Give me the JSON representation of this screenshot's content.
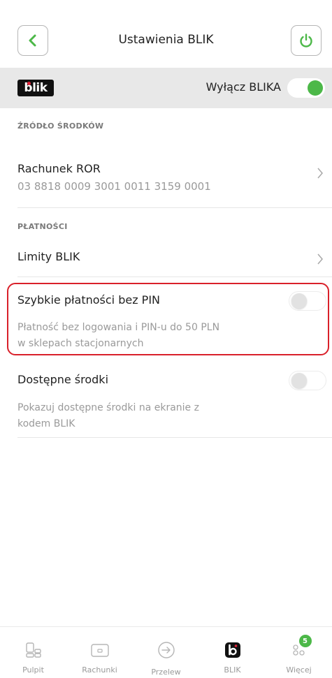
{
  "header": {
    "title": "Ustawienia BLIK",
    "back_icon": "chevron-left-icon",
    "power_icon": "power-icon"
  },
  "blik_bar": {
    "logo_text": "blik",
    "toggle_label": "Wyłącz BLIKA",
    "toggle_on": true
  },
  "source": {
    "section_label": "ŹRÓDŁO ŚRODKÓW",
    "account_name": "Rachunek ROR",
    "account_number": "03 8818 0009 3001 0011 3159 0001"
  },
  "payments": {
    "section_label": "PŁATNOŚCI",
    "limits_label": "Limity BLIK",
    "fast_payments_title": "Szybkie płatności bez PIN",
    "fast_payments_desc_line1": "Płatność bez logowania i PIN-u do 50 PLN",
    "fast_payments_desc_line2": "w sklepach stacjonarnych",
    "fast_payments_on": false,
    "available_funds_title": "Dostępne środki",
    "available_funds_desc_line1": "Pokazuj dostępne środki na ekranie z",
    "available_funds_desc_line2": "kodem BLIK",
    "available_funds_on": false
  },
  "tabbar": {
    "items": [
      {
        "label": "Pulpit",
        "icon": "dashboard-icon"
      },
      {
        "label": "Rachunki",
        "icon": "wallet-icon"
      },
      {
        "label": "Przelew",
        "icon": "transfer-icon"
      },
      {
        "label": "BLIK",
        "icon": "blik-icon"
      },
      {
        "label": "Więcej",
        "icon": "more-icon",
        "badge": "5"
      }
    ]
  },
  "colors": {
    "accent_green": "#4cb848",
    "highlight_red": "#d9202a",
    "blik_bar_bg": "#e8e8e8"
  }
}
